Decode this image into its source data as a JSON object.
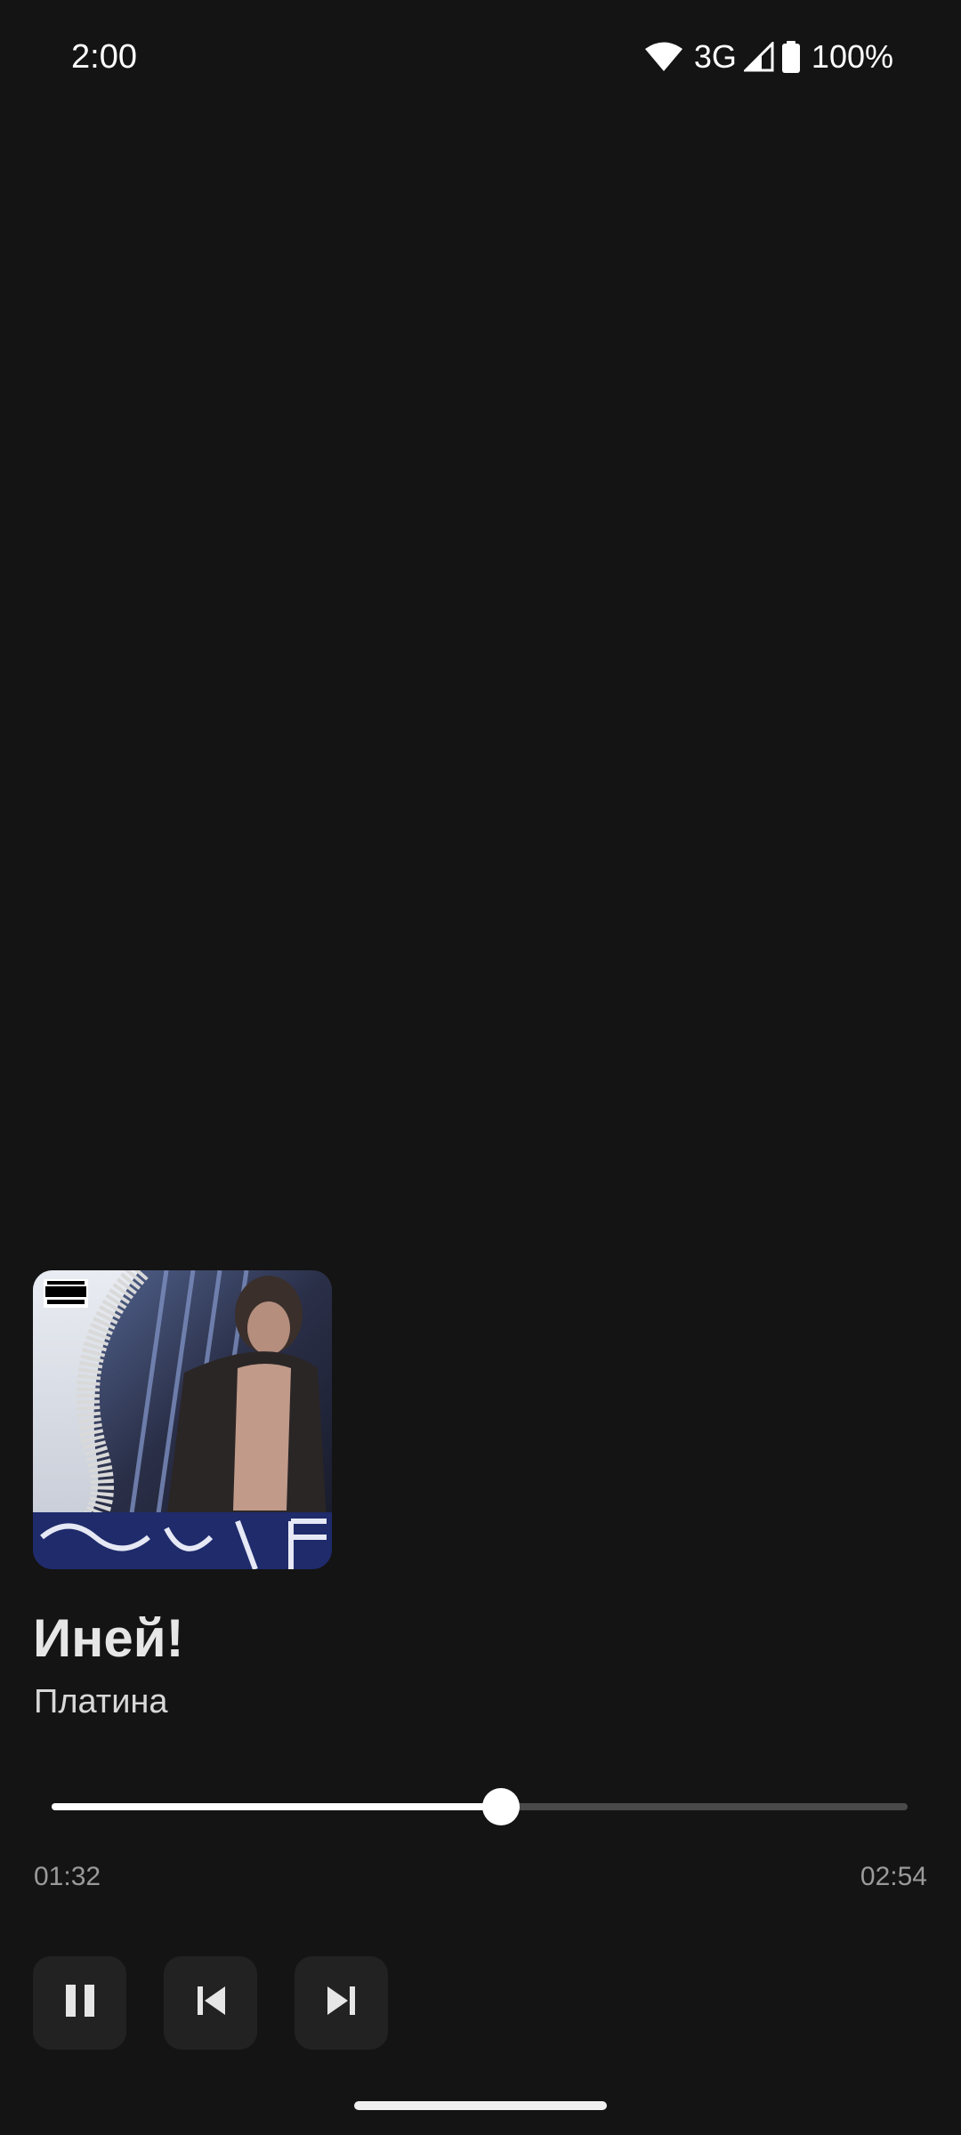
{
  "status_bar": {
    "time": "2:00",
    "network": "3G",
    "battery": "100%",
    "icons": [
      "wifi-icon",
      "cell-signal-icon",
      "battery-icon"
    ]
  },
  "player": {
    "title": "Иней!",
    "artist": "Платина",
    "elapsed": "01:32",
    "total": "02:54",
    "progress_fraction": 0.525,
    "album_art_badge": "PARENTAL ADVISORY EXPLICIT CONTENT",
    "controls": {
      "play_pause": "pause-icon",
      "previous": "skip-previous-icon",
      "next": "skip-next-icon"
    }
  },
  "colors": {
    "background": "#141414",
    "button_background": "#222222",
    "progress_fill": "#ffffff",
    "progress_track": "#4a4a4a"
  }
}
